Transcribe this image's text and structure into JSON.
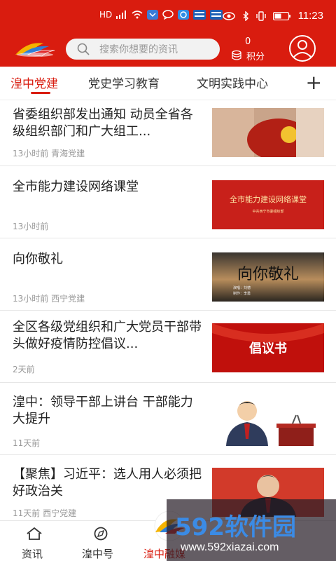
{
  "status": {
    "left_icons": [
      "HD",
      "signal",
      "wifi",
      "app-blue",
      "chat",
      "q",
      "notify1",
      "notify2"
    ],
    "right_icons": [
      "eye",
      "bluetooth",
      "vibrate",
      "battery"
    ],
    "time": "11:23"
  },
  "header": {
    "search_placeholder": "搜索你想要的资讯",
    "points_value": "0",
    "points_label": "积分"
  },
  "tabs": [
    {
      "label": "湟中党建",
      "active": true
    },
    {
      "label": "党史学习教育"
    },
    {
      "label": "文明实践中心"
    }
  ],
  "tabs_plus": "+",
  "news": [
    {
      "title": "省委组织部发出通知  动员全省各级组织部门和广大组工...",
      "meta": "13小时前  青海党建"
    },
    {
      "title": "全市能力建设网络课堂",
      "meta": "13小时前",
      "thumb_text": "全市能力建设网络课堂",
      "thumb_sub": "中共西宁市委组织部"
    },
    {
      "title": "向你敬礼",
      "meta": "13小时前  西宁党建",
      "thumb_text": "向你敬礼",
      "thumb_sub1": "演唱：刘德",
      "thumb_sub2": "制作：李勇"
    },
    {
      "title": "全区各级党组织和广大党员干部带头做好疫情防控倡议...",
      "meta": "2天前",
      "thumb_text": "倡议书"
    },
    {
      "title": "湟中：领导干部上讲台  干部能力大提升",
      "meta": "11天前"
    },
    {
      "title": "【聚焦】习近平：选人用人必须把好政治关",
      "meta": "11天前  西宁党建"
    }
  ],
  "bottom_nav": [
    {
      "label": "资讯"
    },
    {
      "label": "湟中号"
    },
    {
      "label": "湟中融媒",
      "active": true
    }
  ],
  "watermark": {
    "big": "592软件园",
    "url": "www.592xiazai.com"
  },
  "colors": {
    "brand": "#d91c0f",
    "gray_text": "#999999"
  }
}
